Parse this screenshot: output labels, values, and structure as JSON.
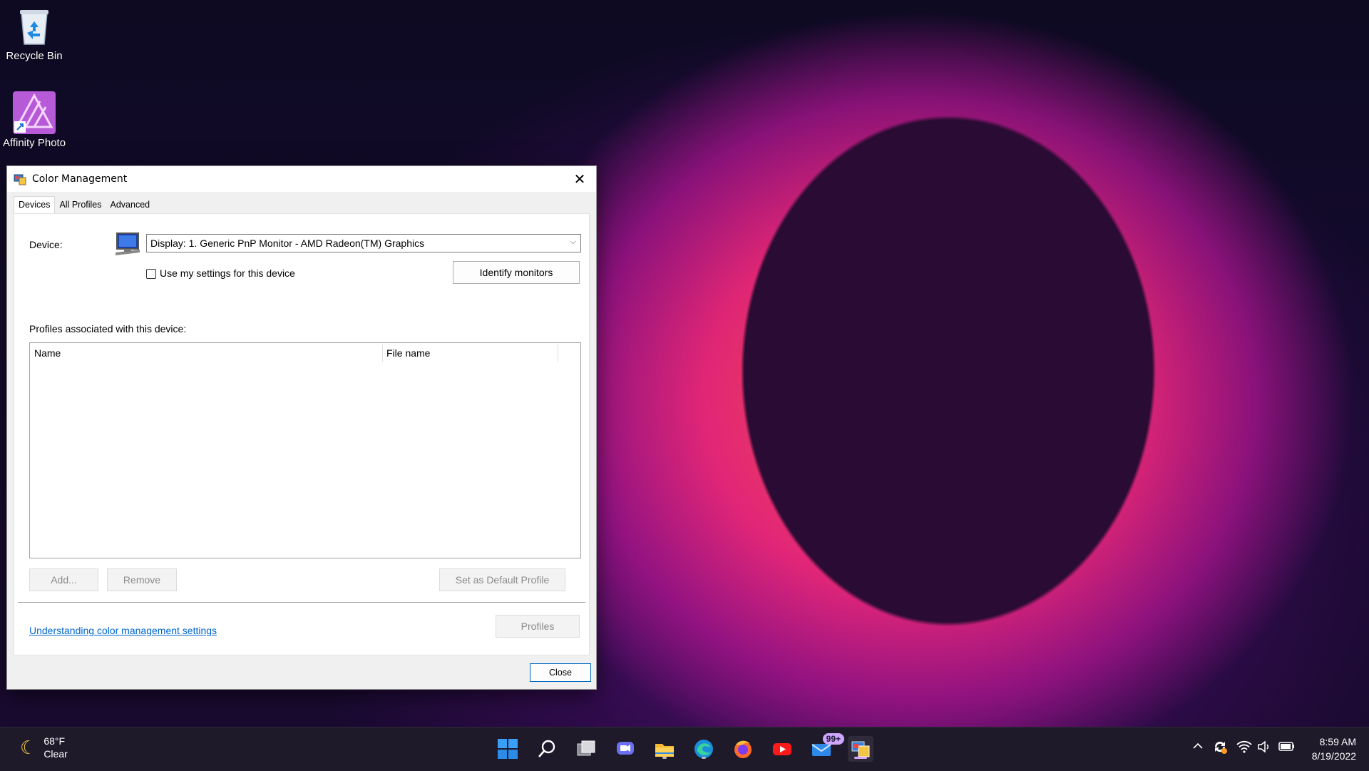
{
  "desktop": {
    "icons": [
      {
        "label": "Recycle Bin"
      },
      {
        "label": "Affinity Photo"
      }
    ]
  },
  "dialog": {
    "title": "Color Management",
    "tabs": [
      "Devices",
      "All Profiles",
      "Advanced"
    ],
    "device_label": "Device:",
    "device_value": "Display: 1. Generic PnP Monitor - AMD Radeon(TM) Graphics",
    "use_settings_label": "Use my settings for this device",
    "use_settings_checked": false,
    "identify_button": "Identify monitors",
    "profiles_label": "Profiles associated with this device:",
    "columns": [
      "Name",
      "File name"
    ],
    "add_button": "Add...",
    "remove_button": "Remove",
    "set_default_button": "Set as Default Profile",
    "link_text": "Understanding color management settings",
    "profiles_button": "Profiles",
    "close_button": "Close"
  },
  "taskbar": {
    "weather_temp": "68°F",
    "weather_desc": "Clear",
    "mail_badge": "99+",
    "time": "8:59 AM",
    "date": "8/19/2022"
  },
  "colors": {
    "accent": "#0067c0",
    "link": "#0066cc",
    "taskbar_bg": "#1e1a2a"
  }
}
